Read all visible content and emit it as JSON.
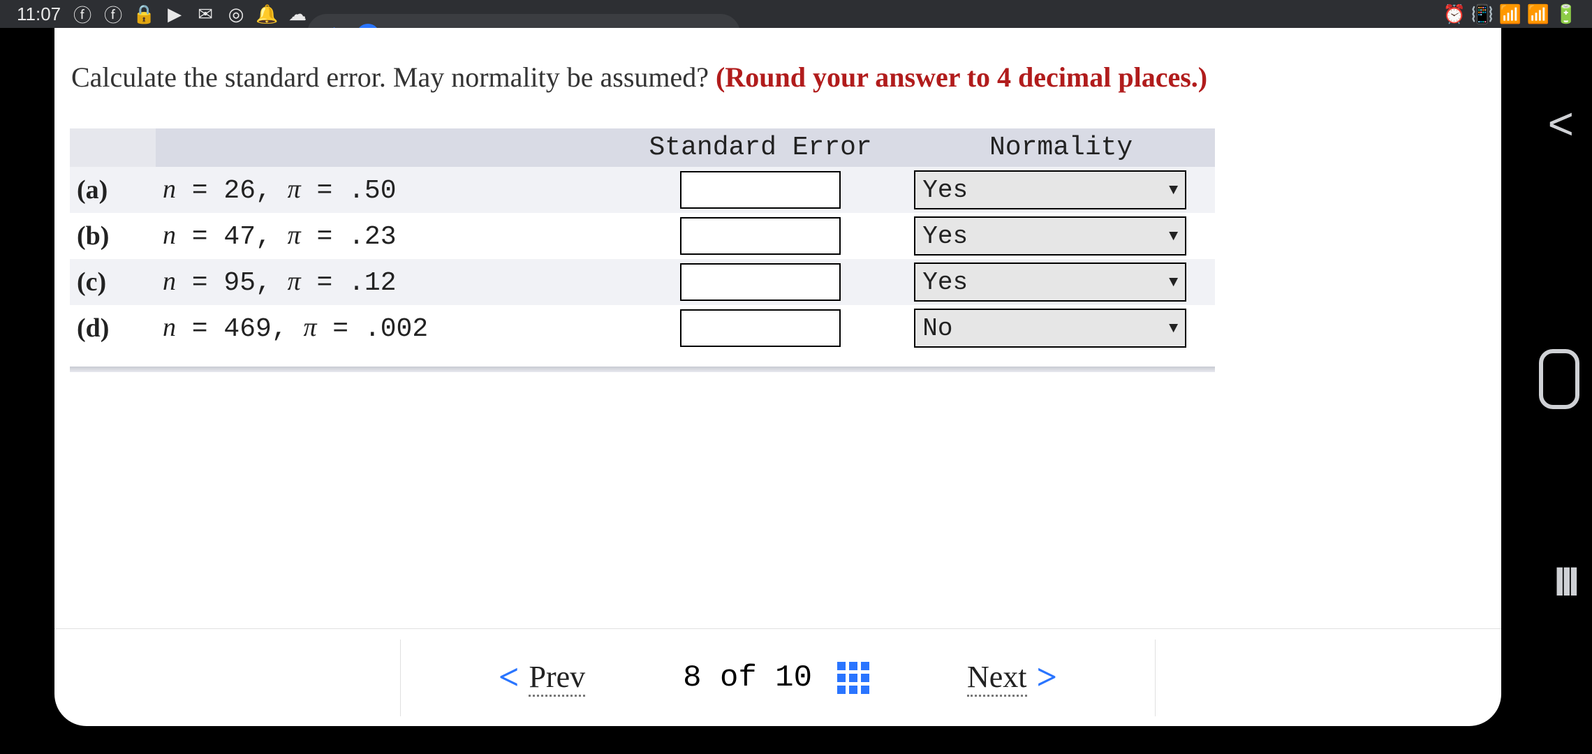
{
  "statusbar": {
    "clock": "11:07"
  },
  "question": {
    "prompt_black": "Calculate the standard error. May normality be assumed? ",
    "prompt_red": "(Round your answer to 4 decimal places.)"
  },
  "table": {
    "headers": {
      "se": "Standard Error",
      "norm": "Normality"
    },
    "rows": [
      {
        "label": "(a)",
        "n": "26",
        "pi": ".50",
        "se": "",
        "norm": "Yes"
      },
      {
        "label": "(b)",
        "n": "47",
        "pi": ".23",
        "se": "",
        "norm": "Yes"
      },
      {
        "label": "(c)",
        "n": "95",
        "pi": ".12",
        "se": "",
        "norm": "Yes"
      },
      {
        "label": "(d)",
        "n": "469",
        "pi": ".002",
        "se": "",
        "norm": "No"
      }
    ]
  },
  "footer": {
    "prev": "Prev",
    "pager": "8 of 10",
    "next": "Next"
  }
}
